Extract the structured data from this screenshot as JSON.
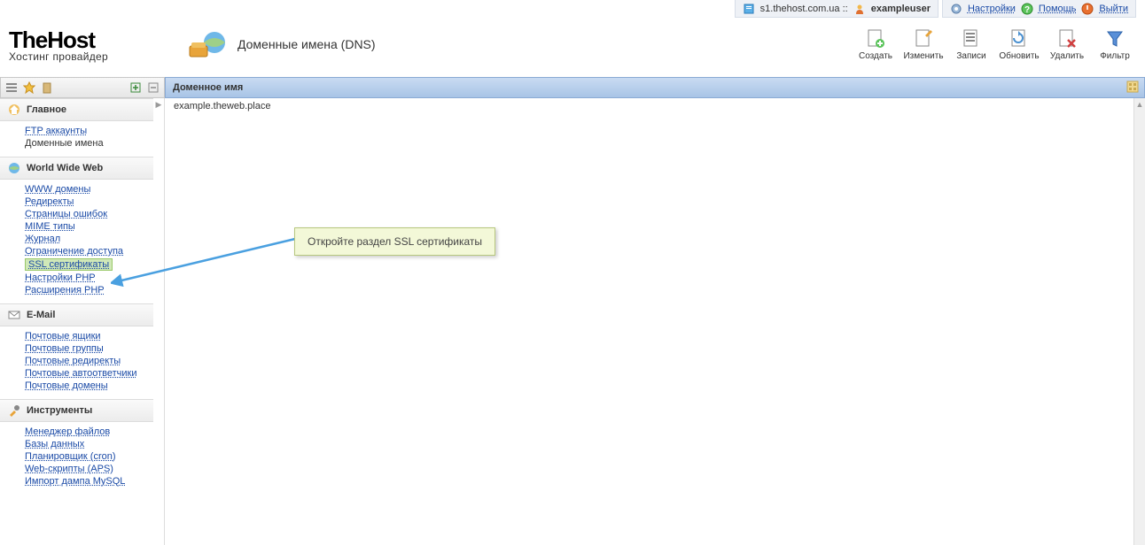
{
  "topbar": {
    "server": "s1.thehost.com.ua ::",
    "user": "exampleuser",
    "settings": "Настройки",
    "help": "Помощь",
    "logout": "Выйти"
  },
  "logo": {
    "title": "TheHost",
    "subtitle": "Хостинг провайдер"
  },
  "page_title": "Доменные имена (DNS)",
  "toolbar": {
    "create": "Создать",
    "edit": "Изменить",
    "records": "Записи",
    "refresh": "Обновить",
    "delete": "Удалить",
    "filter": "Фильтр"
  },
  "column_header": "Доменное имя",
  "row1": "example.theweb.place",
  "sections": [
    {
      "title": "Главное",
      "icon": "home",
      "items": [
        {
          "label": "FTP аккаунты",
          "link": true
        },
        {
          "label": "Доменные имена",
          "link": false
        }
      ]
    },
    {
      "title": "World Wide Web",
      "icon": "globe",
      "items": [
        {
          "label": "WWW домены",
          "link": true
        },
        {
          "label": "Редиректы",
          "link": true
        },
        {
          "label": "Страницы ошибок",
          "link": true
        },
        {
          "label": "MIME типы",
          "link": true
        },
        {
          "label": "Журнал",
          "link": true
        },
        {
          "label": "Ограничение доступа",
          "link": true
        },
        {
          "label": "SSL сертификаты",
          "link": true,
          "highlight": true
        },
        {
          "label": "Настройки PHP",
          "link": true
        },
        {
          "label": "Расширения PHP",
          "link": true
        }
      ]
    },
    {
      "title": "E-Mail",
      "icon": "mail",
      "items": [
        {
          "label": "Почтовые ящики",
          "link": true
        },
        {
          "label": "Почтовые группы",
          "link": true
        },
        {
          "label": "Почтовые редиректы",
          "link": true
        },
        {
          "label": "Почтовые автоответчики",
          "link": true
        },
        {
          "label": "Почтовые домены",
          "link": true
        }
      ]
    },
    {
      "title": "Инструменты",
      "icon": "tools",
      "items": [
        {
          "label": "Менеджер файлов",
          "link": true
        },
        {
          "label": "Базы данных",
          "link": true
        },
        {
          "label": "Планировщик (cron)",
          "link": true
        },
        {
          "label": "Web-скрипты (APS)",
          "link": true
        },
        {
          "label": "Импорт дампа MySQL",
          "link": true
        }
      ]
    }
  ],
  "callout": "Откройте раздел SSL сертификаты"
}
